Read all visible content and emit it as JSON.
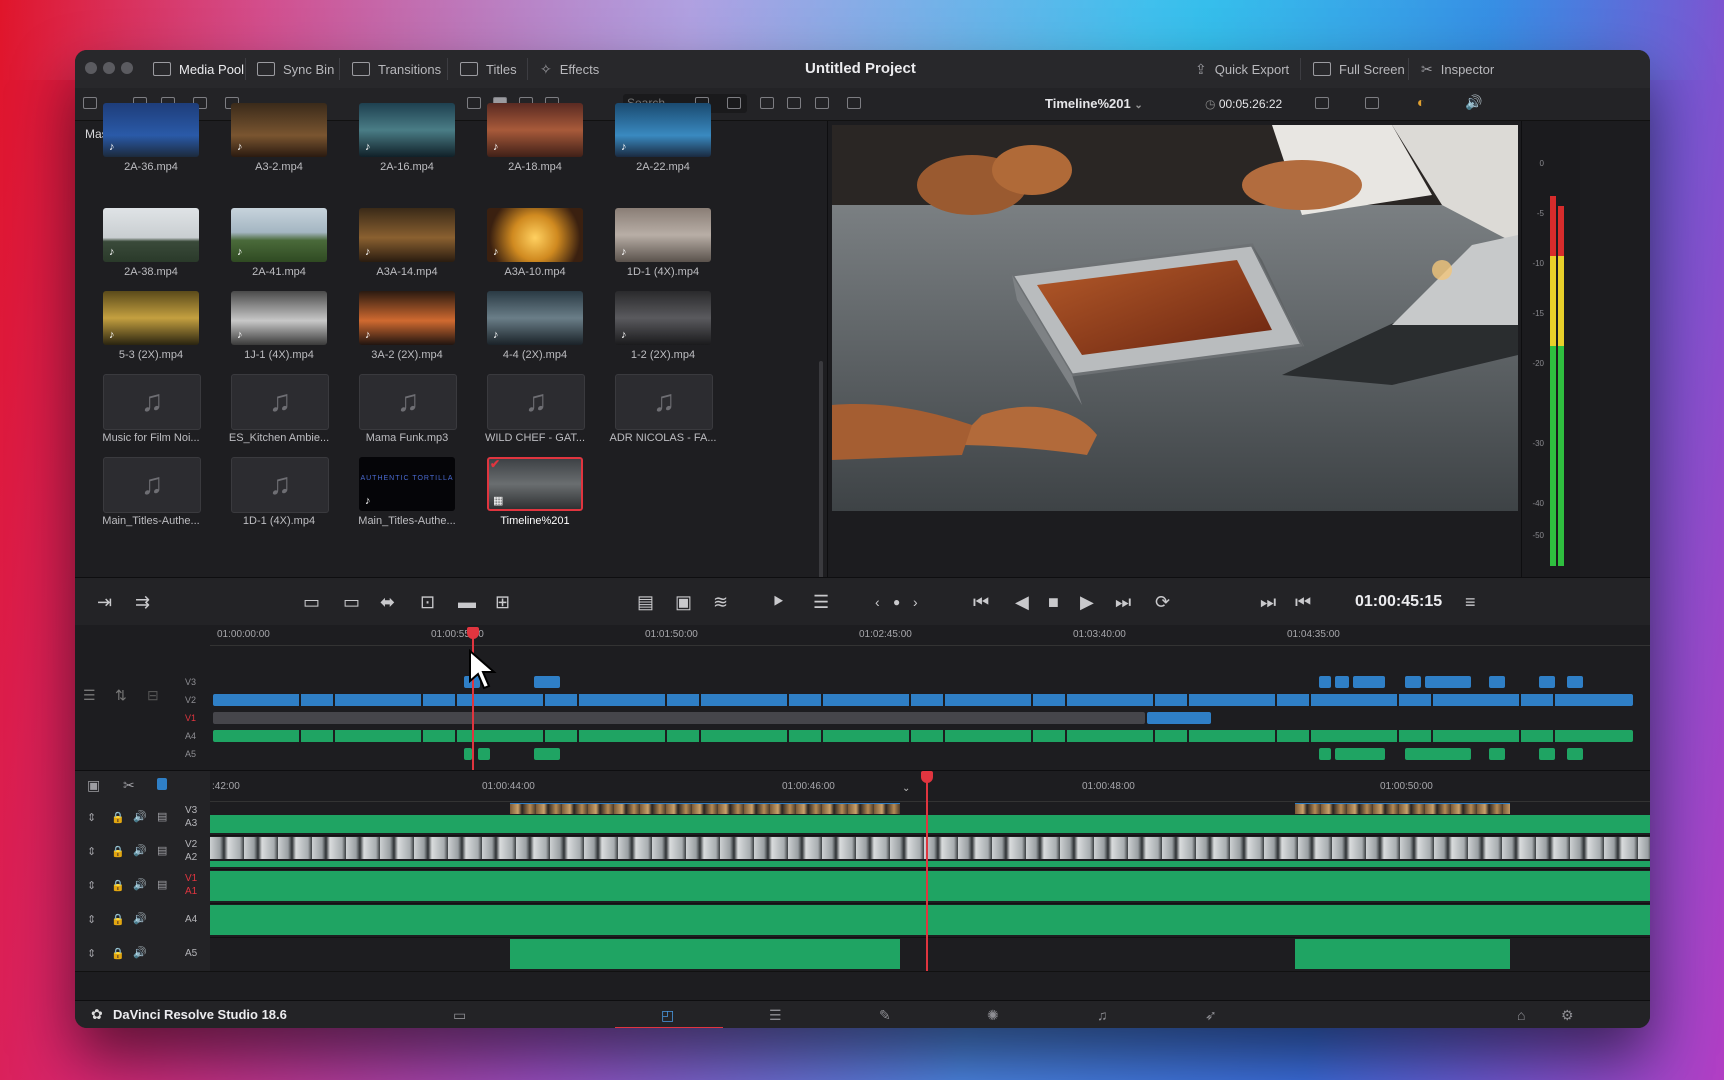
{
  "window": {
    "project_title": "Untitled Project",
    "tabs_left": [
      {
        "label": "Media Pool",
        "icon": "media-pool-icon"
      },
      {
        "label": "Sync Bin",
        "icon": "sync-bin-icon"
      },
      {
        "label": "Transitions",
        "icon": "transitions-icon"
      },
      {
        "label": "Titles",
        "icon": "titles-icon"
      },
      {
        "label": "Effects",
        "icon": "effects-icon"
      }
    ],
    "tabs_right": [
      {
        "label": "Quick Export",
        "icon": "export-icon"
      },
      {
        "label": "Full Screen",
        "icon": "fullscreen-icon"
      },
      {
        "label": "Inspector",
        "icon": "inspector-icon"
      }
    ]
  },
  "media_pool": {
    "search_placeholder": "Search",
    "bin_name": "Master",
    "clips": [
      {
        "name": "2A-36.mp4",
        "kind": "video"
      },
      {
        "name": "A3-2.mp4",
        "kind": "video"
      },
      {
        "name": "2A-16.mp4",
        "kind": "video"
      },
      {
        "name": "2A-18.mp4",
        "kind": "video"
      },
      {
        "name": "2A-22.mp4",
        "kind": "video"
      },
      {
        "name": "2A-38.mp4",
        "kind": "video"
      },
      {
        "name": "2A-41.mp4",
        "kind": "video"
      },
      {
        "name": "A3A-14.mp4",
        "kind": "video"
      },
      {
        "name": "A3A-10.mp4",
        "kind": "video"
      },
      {
        "name": "1D-1 (4X).mp4",
        "kind": "video"
      },
      {
        "name": "5-3 (2X).mp4",
        "kind": "video"
      },
      {
        "name": "1J-1 (4X).mp4",
        "kind": "video"
      },
      {
        "name": "3A-2 (2X).mp4",
        "kind": "video"
      },
      {
        "name": "4-4 (2X).mp4",
        "kind": "video"
      },
      {
        "name": "1-2 (2X).mp4",
        "kind": "video"
      },
      {
        "name": "Music for Film Noi...",
        "kind": "audio"
      },
      {
        "name": "ES_Kitchen Ambie...",
        "kind": "audio"
      },
      {
        "name": "Mama Funk.mp3",
        "kind": "audio"
      },
      {
        "name": "WILD CHEF - GAT...",
        "kind": "audio"
      },
      {
        "name": "ADR NICOLAS - FA...",
        "kind": "audio"
      },
      {
        "name": "Main_Titles-Authe...",
        "kind": "audio"
      },
      {
        "name": "1D-1 (4X).mp4",
        "kind": "audio"
      },
      {
        "name": "Main_Titles-Authe...",
        "kind": "title",
        "thumb_text": "AUTHENTIC TORTILLA"
      },
      {
        "name": "Timeline%201",
        "kind": "timeline",
        "selected": true
      }
    ]
  },
  "viewer": {
    "timeline_name": "Timeline%201",
    "duration": "00:05:26:22",
    "timecode": "01:00:45:15",
    "meter_scale": [
      "0",
      "-5",
      "-10",
      "-15",
      "-20",
      "-30",
      "-40",
      "-50"
    ]
  },
  "mini_timeline": {
    "ruler": [
      "01:00:00:00",
      "01:00:55:00",
      "01:01:50:00",
      "01:02:45:00",
      "01:03:40:00",
      "01:04:35:00"
    ],
    "tracks": [
      "V3",
      "V2",
      "V1",
      "A4",
      "A5"
    ]
  },
  "main_timeline": {
    "ruler": [
      ":42:00",
      "01:00:44:00",
      "01:00:46:00",
      "01:00:48:00",
      "01:00:50:00"
    ],
    "tracks": [
      {
        "top": "V3",
        "bottom": "A3"
      },
      {
        "top": "V2",
        "bottom": "A2"
      },
      {
        "top": "V1",
        "bottom": "A1"
      },
      {
        "top": "A4",
        "bottom": ""
      },
      {
        "top": "A5",
        "bottom": ""
      }
    ]
  },
  "bottom_bar": {
    "app_name": "DaVinci Resolve Studio 18.6",
    "pages": [
      "media-page-icon",
      "cut-page-icon",
      "edit-page-icon",
      "fusion-page-icon",
      "color-page-icon",
      "fairlight-page-icon",
      "deliver-page-icon"
    ]
  },
  "colors": {
    "accent_red": "#e0353f",
    "video_clip": "#2f7fc6",
    "audio_clip": "#1fa463"
  }
}
